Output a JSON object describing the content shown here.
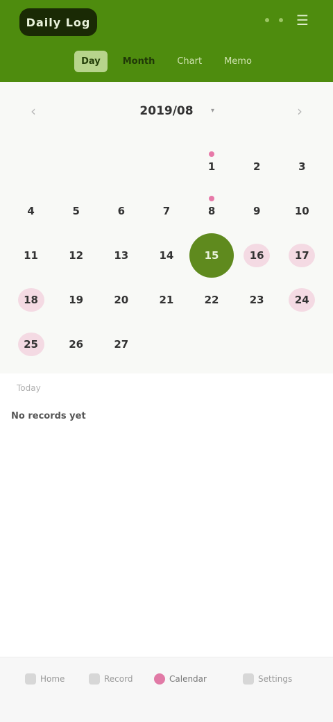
{
  "header": {
    "title": "Daily Log",
    "more_icon": "more-dots-icon",
    "menu_icon": "menu-icon"
  },
  "tabs": [
    {
      "label": "Day"
    },
    {
      "label": "Month"
    },
    {
      "label": "Chart"
    },
    {
      "label": "Memo"
    }
  ],
  "calendar": {
    "month_label": "2019/08",
    "prev_label": "‹",
    "next_label": "›",
    "today": 15,
    "days": [
      {
        "d": ""
      },
      {
        "d": ""
      },
      {
        "d": ""
      },
      {
        "d": ""
      },
      {
        "d": "1"
      },
      {
        "d": "2"
      },
      {
        "d": "3"
      },
      {
        "d": "4"
      },
      {
        "d": "5"
      },
      {
        "d": "6"
      },
      {
        "d": "7"
      },
      {
        "d": "8"
      },
      {
        "d": "9"
      },
      {
        "d": "10"
      },
      {
        "d": "11"
      },
      {
        "d": "12"
      },
      {
        "d": "13"
      },
      {
        "d": "14"
      },
      {
        "d": "15"
      },
      {
        "d": "16"
      },
      {
        "d": "17"
      },
      {
        "d": "18"
      },
      {
        "d": "19"
      },
      {
        "d": "20"
      },
      {
        "d": "21"
      },
      {
        "d": "22"
      },
      {
        "d": "23"
      },
      {
        "d": "24"
      },
      {
        "d": "25"
      },
      {
        "d": "26"
      },
      {
        "d": "27"
      }
    ]
  },
  "info": {
    "small_text": "Today",
    "line_text": "No records yet"
  },
  "bottom_nav": [
    {
      "label": "Home",
      "icon": "home-icon"
    },
    {
      "label": "Record",
      "icon": "record-icon"
    },
    {
      "label": "Calendar",
      "icon": "calendar-icon"
    },
    {
      "label": "Settings",
      "icon": "settings-icon"
    }
  ],
  "colors": {
    "header_green": "#4e8c0e",
    "today_green": "#5f8a1e",
    "accent_pink": "#e46aa0"
  }
}
